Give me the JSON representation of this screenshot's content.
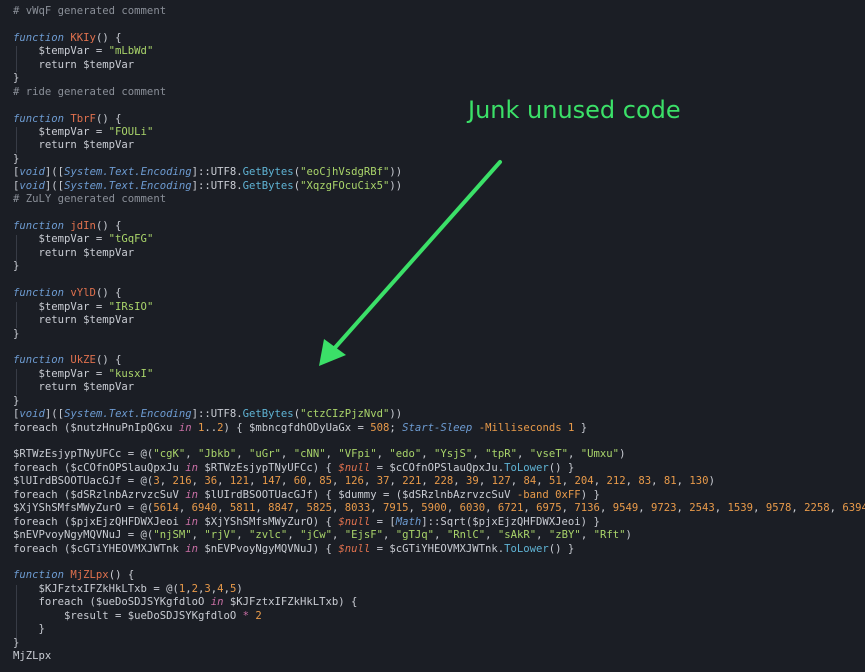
{
  "annotation": {
    "text": "Junk unused code",
    "color": "#3be068"
  },
  "colors": {
    "background": "#1b1e25",
    "comment": "#8a8f98",
    "keyword": "#6d9bd1",
    "function_name": "#e0714e",
    "string": "#a9d46a",
    "number": "#e89a4a",
    "method": "#5fb3d4"
  },
  "code": [
    [
      [
        "cm",
        "# vWqF generated comment"
      ]
    ],
    [],
    [
      [
        "kw",
        "function"
      ],
      [
        "plain",
        " "
      ],
      [
        "fn",
        "KKIy"
      ],
      [
        "plain",
        "() {"
      ]
    ],
    [
      [
        "plain",
        "    $tempVar = "
      ],
      [
        "str",
        "\"mLbWd\""
      ]
    ],
    [
      [
        "plain",
        "    return $tempVar"
      ]
    ],
    [
      [
        "plain",
        "}"
      ]
    ],
    [
      [
        "cm",
        "# ride generated comment"
      ]
    ],
    [],
    [
      [
        "kw",
        "function"
      ],
      [
        "plain",
        " "
      ],
      [
        "fn",
        "TbrF"
      ],
      [
        "plain",
        "() {"
      ]
    ],
    [
      [
        "plain",
        "    $tempVar = "
      ],
      [
        "str",
        "\"FOULi\""
      ]
    ],
    [
      [
        "plain",
        "    return $tempVar"
      ]
    ],
    [
      [
        "plain",
        "}"
      ]
    ],
    [
      [
        "plain",
        "["
      ],
      [
        "ty",
        "void"
      ],
      [
        "plain",
        "]("
      ],
      [
        "plain",
        "["
      ],
      [
        "ty",
        "System.Text.Encoding"
      ],
      [
        "plain",
        "]::UTF8."
      ],
      [
        "meth",
        "GetBytes"
      ],
      [
        "plain",
        "("
      ],
      [
        "str",
        "\"eoCjhVsdgRBf\""
      ],
      [
        "plain",
        "))"
      ]
    ],
    [
      [
        "plain",
        "["
      ],
      [
        "ty",
        "void"
      ],
      [
        "plain",
        "]("
      ],
      [
        "plain",
        "["
      ],
      [
        "ty",
        "System.Text.Encoding"
      ],
      [
        "plain",
        "]::UTF8."
      ],
      [
        "meth",
        "GetBytes"
      ],
      [
        "plain",
        "("
      ],
      [
        "str",
        "\"XqzgFOcuCix5\""
      ],
      [
        "plain",
        "))"
      ]
    ],
    [
      [
        "cm",
        "# ZuLY generated comment"
      ]
    ],
    [],
    [
      [
        "kw",
        "function"
      ],
      [
        "plain",
        " "
      ],
      [
        "fn",
        "jdIn"
      ],
      [
        "plain",
        "() {"
      ]
    ],
    [
      [
        "plain",
        "    $tempVar = "
      ],
      [
        "str",
        "\"tGqFG\""
      ]
    ],
    [
      [
        "plain",
        "    return $tempVar"
      ]
    ],
    [
      [
        "plain",
        "}"
      ]
    ],
    [],
    [
      [
        "kw",
        "function"
      ],
      [
        "plain",
        " "
      ],
      [
        "fn",
        "vYlD"
      ],
      [
        "plain",
        "() {"
      ]
    ],
    [
      [
        "plain",
        "    $tempVar = "
      ],
      [
        "str",
        "\"IRsIO\""
      ]
    ],
    [
      [
        "plain",
        "    return $tempVar"
      ]
    ],
    [
      [
        "plain",
        "}"
      ]
    ],
    [],
    [
      [
        "kw",
        "function"
      ],
      [
        "plain",
        " "
      ],
      [
        "fn",
        "UkZE"
      ],
      [
        "plain",
        "() {"
      ]
    ],
    [
      [
        "plain",
        "    $tempVar = "
      ],
      [
        "str",
        "\"kusxI\""
      ]
    ],
    [
      [
        "plain",
        "    return $tempVar"
      ]
    ],
    [
      [
        "plain",
        "}"
      ]
    ],
    [
      [
        "plain",
        "["
      ],
      [
        "ty",
        "void"
      ],
      [
        "plain",
        "]("
      ],
      [
        "plain",
        "["
      ],
      [
        "ty",
        "System.Text.Encoding"
      ],
      [
        "plain",
        "]::UTF8."
      ],
      [
        "meth",
        "GetBytes"
      ],
      [
        "plain",
        "("
      ],
      [
        "str",
        "\"ctzCIzPjzNvd\""
      ],
      [
        "plain",
        "))"
      ]
    ],
    [
      [
        "plain",
        "foreach ($nutzHnuPnIpQGxu "
      ],
      [
        "op",
        "in"
      ],
      [
        "plain",
        " "
      ],
      [
        "num",
        "1"
      ],
      [
        "plain",
        ".."
      ],
      [
        "num",
        "2"
      ],
      [
        "plain",
        ") { $mbncgfdhODyUaGx = "
      ],
      [
        "num",
        "508"
      ],
      [
        "plain",
        "; "
      ],
      [
        "sleep",
        "Start-Sleep"
      ],
      [
        "plain",
        " "
      ],
      [
        "par",
        "-Milliseconds"
      ],
      [
        "plain",
        " "
      ],
      [
        "num",
        "1"
      ],
      [
        "plain",
        " }"
      ]
    ],
    [],
    [
      [
        "plain",
        "$RTWzEsjypTNyUFCc = @("
      ],
      [
        "str",
        "\"cgK\""
      ],
      [
        "plain",
        ", "
      ],
      [
        "str",
        "\"Jbkb\""
      ],
      [
        "plain",
        ", "
      ],
      [
        "str",
        "\"uGr\""
      ],
      [
        "plain",
        ", "
      ],
      [
        "str",
        "\"cNN\""
      ],
      [
        "plain",
        ", "
      ],
      [
        "str",
        "\"VFpi\""
      ],
      [
        "plain",
        ", "
      ],
      [
        "str",
        "\"edo\""
      ],
      [
        "plain",
        ", "
      ],
      [
        "str",
        "\"YsjS\""
      ],
      [
        "plain",
        ", "
      ],
      [
        "str",
        "\"tpR\""
      ],
      [
        "plain",
        ", "
      ],
      [
        "str",
        "\"vseT\""
      ],
      [
        "plain",
        ", "
      ],
      [
        "str",
        "\"Umxu\""
      ],
      [
        "plain",
        ")"
      ]
    ],
    [
      [
        "plain",
        "foreach ($cCOfnOPSlauQpxJu "
      ],
      [
        "op",
        "in"
      ],
      [
        "plain",
        " $RTWzEsjypTNyUFCc) { "
      ],
      [
        "nul",
        "$null"
      ],
      [
        "plain",
        " = $cCOfnOPSlauQpxJu."
      ],
      [
        "meth",
        "ToLower"
      ],
      [
        "plain",
        "() }"
      ]
    ],
    [
      [
        "plain",
        "$lUIrdBSOOTUacGJf = @("
      ],
      [
        "num",
        "3"
      ],
      [
        "plain",
        ", "
      ],
      [
        "num",
        "216"
      ],
      [
        "plain",
        ", "
      ],
      [
        "num",
        "36"
      ],
      [
        "plain",
        ", "
      ],
      [
        "num",
        "121"
      ],
      [
        "plain",
        ", "
      ],
      [
        "num",
        "147"
      ],
      [
        "plain",
        ", "
      ],
      [
        "num",
        "60"
      ],
      [
        "plain",
        ", "
      ],
      [
        "num",
        "85"
      ],
      [
        "plain",
        ", "
      ],
      [
        "num",
        "126"
      ],
      [
        "plain",
        ", "
      ],
      [
        "num",
        "37"
      ],
      [
        "plain",
        ", "
      ],
      [
        "num",
        "221"
      ],
      [
        "plain",
        ", "
      ],
      [
        "num",
        "228"
      ],
      [
        "plain",
        ", "
      ],
      [
        "num",
        "39"
      ],
      [
        "plain",
        ", "
      ],
      [
        "num",
        "127"
      ],
      [
        "plain",
        ", "
      ],
      [
        "num",
        "84"
      ],
      [
        "plain",
        ", "
      ],
      [
        "num",
        "51"
      ],
      [
        "plain",
        ", "
      ],
      [
        "num",
        "204"
      ],
      [
        "plain",
        ", "
      ],
      [
        "num",
        "212"
      ],
      [
        "plain",
        ", "
      ],
      [
        "num",
        "83"
      ],
      [
        "plain",
        ", "
      ],
      [
        "num",
        "81"
      ],
      [
        "plain",
        ", "
      ],
      [
        "num",
        "130"
      ],
      [
        "plain",
        ")"
      ]
    ],
    [
      [
        "plain",
        "foreach ($dSRzlnbAzrvzcSuV "
      ],
      [
        "op",
        "in"
      ],
      [
        "plain",
        " $lUIrdBSOOTUacGJf) { $dummy = ($dSRzlnbAzrvzcSuV "
      ],
      [
        "par",
        "-band"
      ],
      [
        "plain",
        " "
      ],
      [
        "num",
        "0xFF"
      ],
      [
        "plain",
        ") }"
      ]
    ],
    [
      [
        "plain",
        "$XjYShSMfsMWyZurO = @("
      ],
      [
        "num",
        "5614"
      ],
      [
        "plain",
        ", "
      ],
      [
        "num",
        "6940"
      ],
      [
        "plain",
        ", "
      ],
      [
        "num",
        "5811"
      ],
      [
        "plain",
        ", "
      ],
      [
        "num",
        "8847"
      ],
      [
        "plain",
        ", "
      ],
      [
        "num",
        "5825"
      ],
      [
        "plain",
        ", "
      ],
      [
        "num",
        "8033"
      ],
      [
        "plain",
        ", "
      ],
      [
        "num",
        "7915"
      ],
      [
        "plain",
        ", "
      ],
      [
        "num",
        "5900"
      ],
      [
        "plain",
        ", "
      ],
      [
        "num",
        "6030"
      ],
      [
        "plain",
        ", "
      ],
      [
        "num",
        "6721"
      ],
      [
        "plain",
        ", "
      ],
      [
        "num",
        "6975"
      ],
      [
        "plain",
        ", "
      ],
      [
        "num",
        "7136"
      ],
      [
        "plain",
        ", "
      ],
      [
        "num",
        "9549"
      ],
      [
        "plain",
        ", "
      ],
      [
        "num",
        "9723"
      ],
      [
        "plain",
        ", "
      ],
      [
        "num",
        "2543"
      ],
      [
        "plain",
        ", "
      ],
      [
        "num",
        "1539"
      ],
      [
        "plain",
        ", "
      ],
      [
        "num",
        "9578"
      ],
      [
        "plain",
        ", "
      ],
      [
        "num",
        "2258"
      ],
      [
        "plain",
        ", "
      ],
      [
        "num",
        "6394"
      ]
    ],
    [
      [
        "plain",
        "foreach ($pjxEjzQHFDWXJeoi "
      ],
      [
        "op",
        "in"
      ],
      [
        "plain",
        " $XjYShSMfsMWyZurO) { "
      ],
      [
        "nul",
        "$null"
      ],
      [
        "plain",
        " = ["
      ],
      [
        "ty",
        "Math"
      ],
      [
        "plain",
        "]::Sqrt($pjxEjzQHFDWXJeoi) }"
      ]
    ],
    [
      [
        "plain",
        "$nEVPvoyNgyMQVNuJ = @("
      ],
      [
        "str",
        "\"njSM\""
      ],
      [
        "plain",
        ", "
      ],
      [
        "str",
        "\"rjV\""
      ],
      [
        "plain",
        ", "
      ],
      [
        "str",
        "\"zvlc\""
      ],
      [
        "plain",
        ", "
      ],
      [
        "str",
        "\"jCw\""
      ],
      [
        "plain",
        ", "
      ],
      [
        "str",
        "\"EjsF\""
      ],
      [
        "plain",
        ", "
      ],
      [
        "str",
        "\"gTJq\""
      ],
      [
        "plain",
        ", "
      ],
      [
        "str",
        "\"RnlC\""
      ],
      [
        "plain",
        ", "
      ],
      [
        "str",
        "\"sAkR\""
      ],
      [
        "plain",
        ", "
      ],
      [
        "str",
        "\"zBY\""
      ],
      [
        "plain",
        ", "
      ],
      [
        "str",
        "\"Rft\""
      ],
      [
        "plain",
        ")"
      ]
    ],
    [
      [
        "plain",
        "foreach ($cGTiYHEOVMXJWTnk "
      ],
      [
        "op",
        "in"
      ],
      [
        "plain",
        " $nEVPvoyNgyMQVNuJ) { "
      ],
      [
        "nul",
        "$null"
      ],
      [
        "plain",
        " = $cGTiYHEOVMXJWTnk."
      ],
      [
        "meth",
        "ToLower"
      ],
      [
        "plain",
        "() }"
      ]
    ],
    [],
    [
      [
        "kw",
        "function"
      ],
      [
        "plain",
        " "
      ],
      [
        "fn",
        "MjZLpx"
      ],
      [
        "plain",
        "() {"
      ]
    ],
    [
      [
        "plain",
        "    $KJFztxIFZkHkLTxb = @("
      ],
      [
        "num",
        "1"
      ],
      [
        "plain",
        ","
      ],
      [
        "num",
        "2"
      ],
      [
        "plain",
        ","
      ],
      [
        "num",
        "3"
      ],
      [
        "plain",
        ","
      ],
      [
        "num",
        "4"
      ],
      [
        "plain",
        ","
      ],
      [
        "num",
        "5"
      ],
      [
        "plain",
        ")"
      ]
    ],
    [
      [
        "plain",
        "    foreach ($ueDoSDJSYKgfdloO "
      ],
      [
        "op",
        "in"
      ],
      [
        "plain",
        " $KJFztxIFZkHkLTxb) {"
      ]
    ],
    [
      [
        "plain",
        "        $result = $ueDoSDJSYKgfdloO "
      ],
      [
        "op",
        "*"
      ],
      [
        "plain",
        " "
      ],
      [
        "num",
        "2"
      ]
    ],
    [
      [
        "plain",
        "    }"
      ]
    ],
    [
      [
        "plain",
        "}"
      ]
    ],
    [
      [
        "plain",
        "MjZLpx"
      ]
    ]
  ]
}
